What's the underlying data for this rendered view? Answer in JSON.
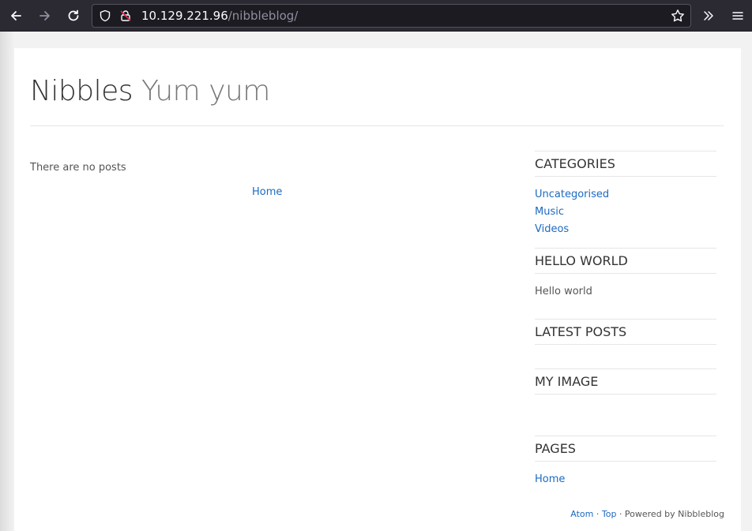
{
  "browser": {
    "url_host": "10.129.221.96",
    "url_path": "/nibbleblog/",
    "icons": [
      "back-arrow-icon",
      "forward-arrow-icon",
      "reload-icon",
      "shield-icon",
      "insecure-lock-icon",
      "star-icon",
      "overflow-chevrons-icon",
      "hamburger-menu-icon"
    ]
  },
  "site": {
    "title": "Nibbles",
    "slogan": "Yum yum"
  },
  "main": {
    "no_posts": "There are no posts",
    "pager_home": "Home"
  },
  "sidebar": {
    "categories": {
      "title": "CATEGORIES",
      "items": [
        "Uncategorised",
        "Music",
        "Videos"
      ]
    },
    "hello": {
      "title": "HELLO WORLD",
      "text": "Hello world"
    },
    "latest": {
      "title": "LATEST POSTS"
    },
    "image": {
      "title": "MY IMAGE"
    },
    "pages": {
      "title": "PAGES",
      "items": [
        "Home"
      ]
    }
  },
  "footer": {
    "atom": "Atom",
    "sep1": " · ",
    "top": "Top",
    "powered": " · Powered by Nibbleblog"
  },
  "colors": {
    "link": "#1b6ac2",
    "toolbar_bg": "#2b2a33",
    "text": "#333333"
  }
}
